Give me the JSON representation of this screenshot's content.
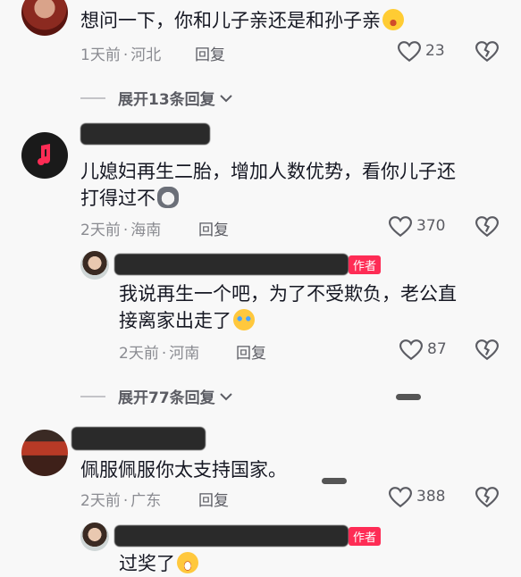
{
  "comments": [
    {
      "text": "想问一下，你和儿子亲还是和孙子亲",
      "time": "1天前",
      "location": "河北",
      "reply_label": "回复",
      "likes": "23"
    },
    {
      "text_line1": "儿媳妇再生二胎，增加人数优势，看你儿子还",
      "text_line2": "打得过不",
      "time": "2天前",
      "location": "海南",
      "reply_label": "回复",
      "likes": "370"
    },
    {
      "text_line1": "我说再生一个吧，为了不受欺负，老公直",
      "text_line2": "接离家出走了",
      "badge": "作者",
      "time": "2天前",
      "location": "河南",
      "reply_label": "回复",
      "likes": "87"
    },
    {
      "text": "佩服佩服你太支持国家。",
      "time": "2天前",
      "location": "广东",
      "reply_label": "回复",
      "likes": "388"
    },
    {
      "text": "过奖了",
      "badge": "作者"
    }
  ],
  "expand": [
    {
      "label": "展开13条回复"
    },
    {
      "label": "展开77条回复"
    }
  ],
  "separator": "·",
  "icons": {
    "like": "heart-icon",
    "dislike": "broken-heart-icon",
    "expand": "chevron-down-icon"
  },
  "colors": {
    "accent": "#fe2c55",
    "meta": "#8a8b91",
    "text": "#161823"
  }
}
